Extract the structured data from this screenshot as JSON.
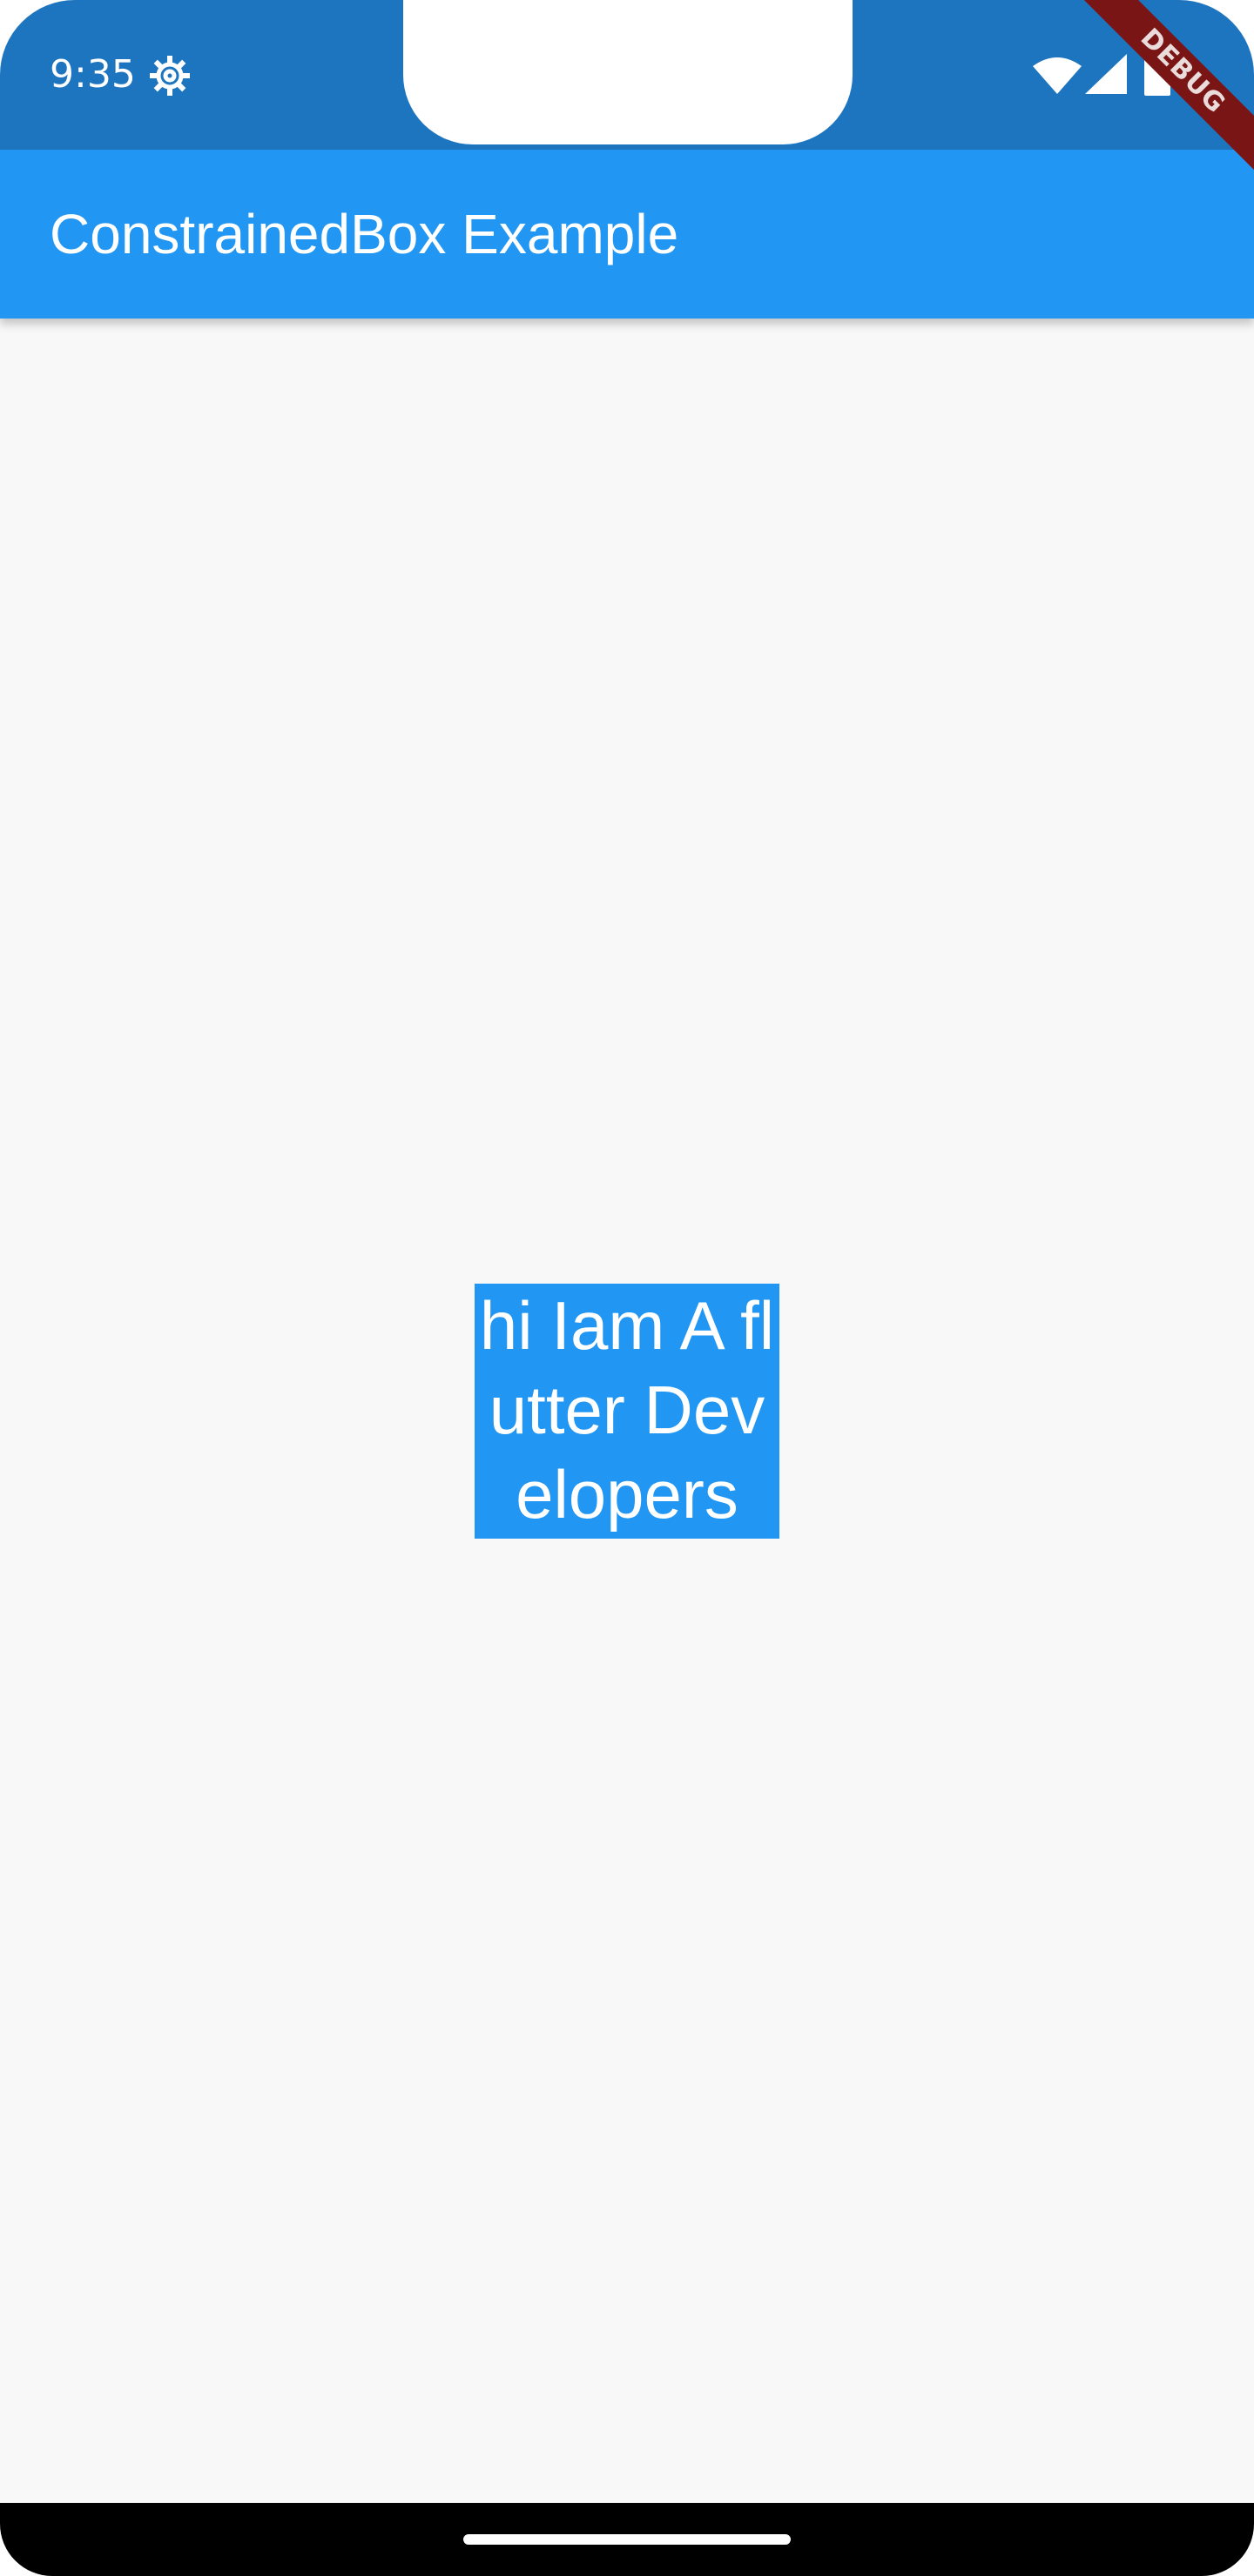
{
  "status_bar": {
    "time": "9:35",
    "icons": [
      "gear-icon",
      "wifi-icon",
      "signal-icon",
      "battery-icon"
    ]
  },
  "app_bar": {
    "title": "ConstrainedBox Example"
  },
  "debug_banner": {
    "label": "DEBUG"
  },
  "body": {
    "box_text": "hi Iam A flutter Developers"
  },
  "colors": {
    "status_bar": "#1e75bf",
    "app_bar": "#2196f3",
    "box": "#2196f3",
    "background": "#f8f8f8",
    "debug_banner": "#7a1515",
    "nav_bar": "#000000"
  }
}
